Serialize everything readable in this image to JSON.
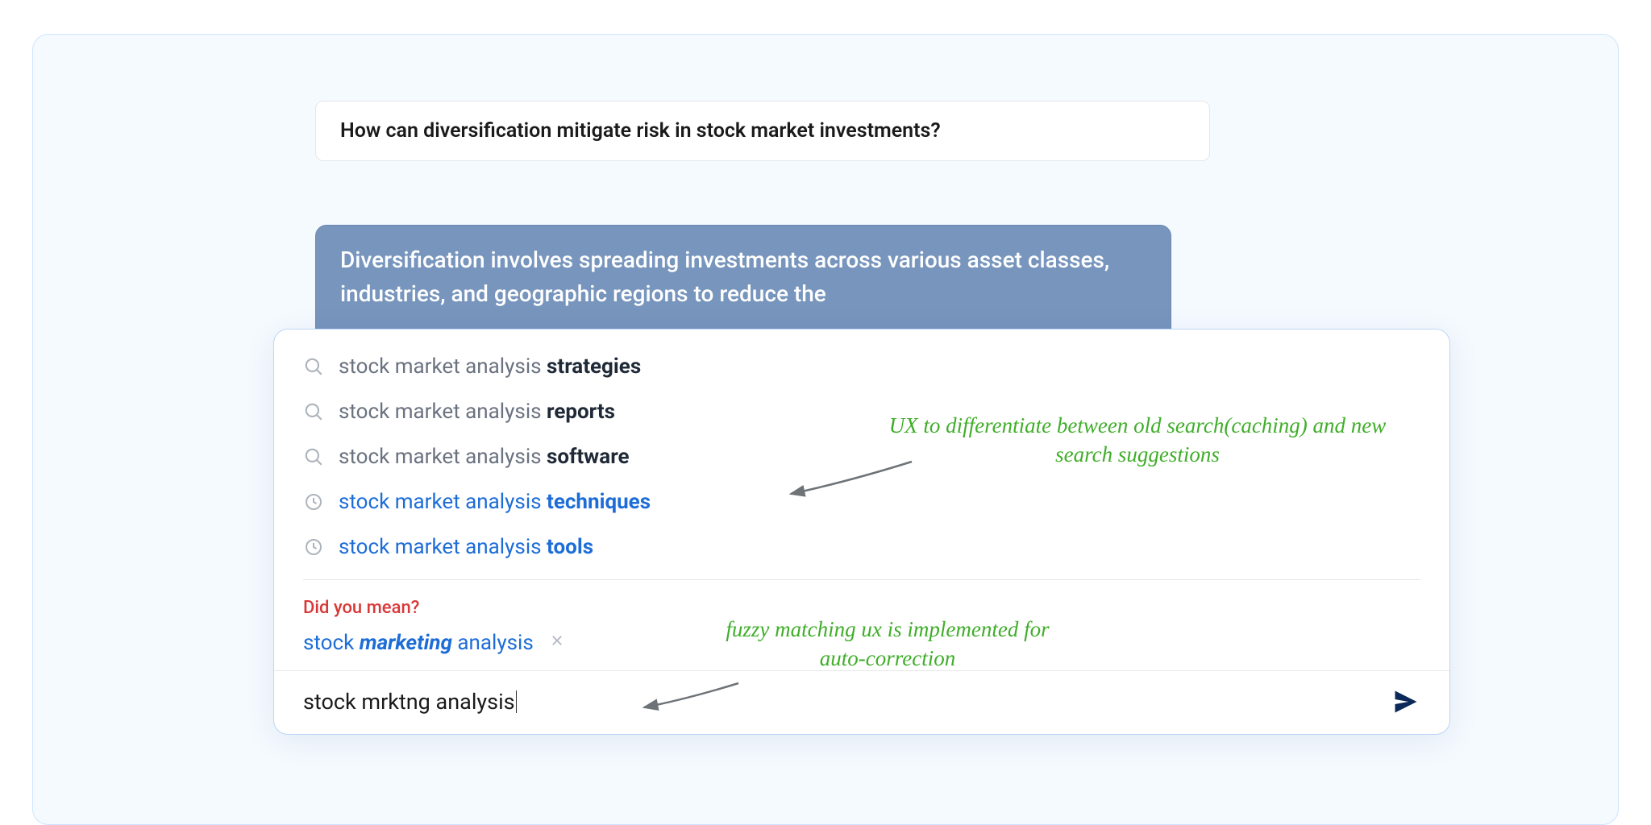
{
  "question": "How can diversification mitigate risk in stock market investments?",
  "answer": "Diversification involves spreading investments across various asset classes, industries, and geographic regions to reduce the",
  "suggestions": [
    {
      "type": "new",
      "prefix": "stock market analysis ",
      "bold": "strategies"
    },
    {
      "type": "new",
      "prefix": "stock market analysis ",
      "bold": "reports"
    },
    {
      "type": "new",
      "prefix": "stock market analysis ",
      "bold": "software"
    },
    {
      "type": "history",
      "prefix": "stock market analysis ",
      "bold": "techniques"
    },
    {
      "type": "history",
      "prefix": "stock market analysis ",
      "bold": "tools"
    }
  ],
  "didYouMean": {
    "label": "Did you mean?",
    "before": "stock ",
    "italic": "marketing",
    "after": " analysis"
  },
  "input": "stock mrktng analysis",
  "annotations": {
    "note1": "UX to differentiate between old search(caching) and new search suggestions",
    "note2": "fuzzy matching ux is implemented for auto-correction"
  },
  "colors": {
    "link": "#1d6dd8",
    "error": "#d93838",
    "annotation": "#3fae29"
  }
}
